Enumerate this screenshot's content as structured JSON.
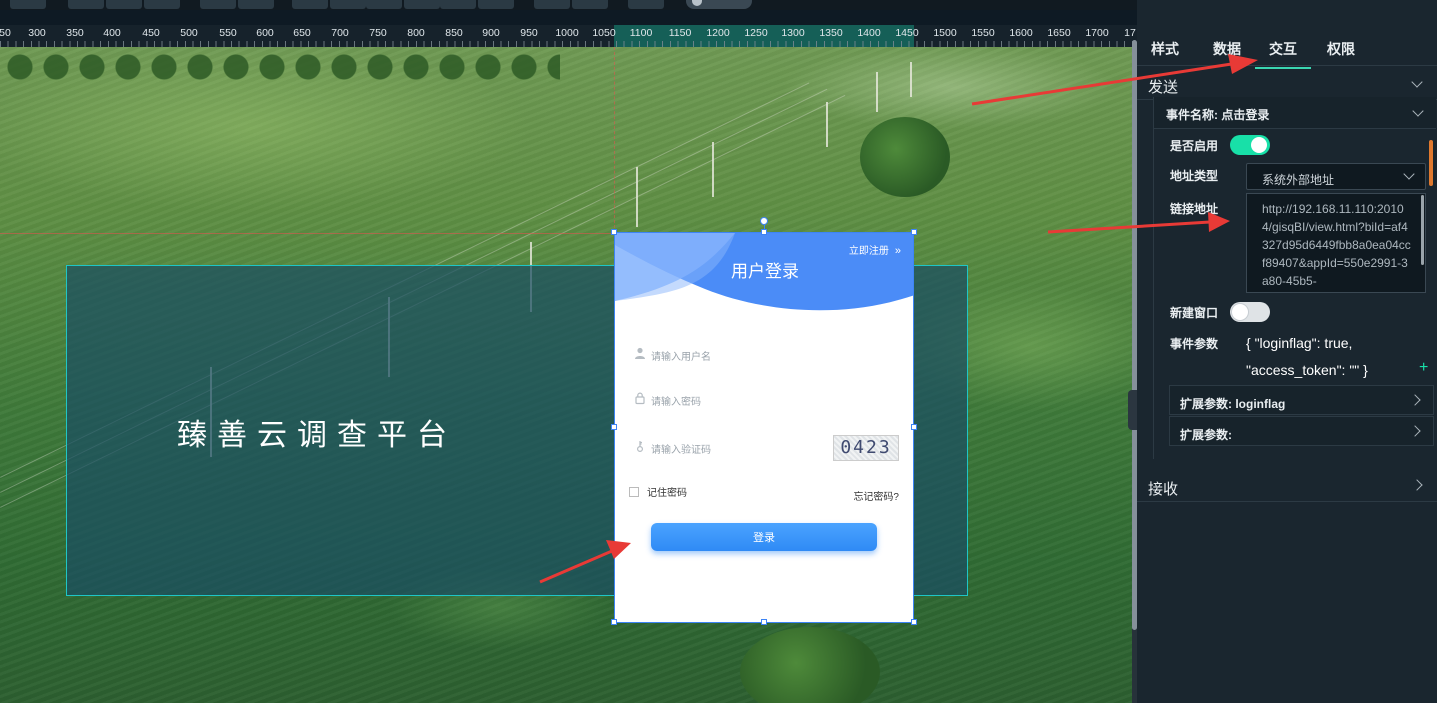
{
  "ruler": {
    "labels": [
      "50",
      "300",
      "350",
      "400",
      "450",
      "500",
      "550",
      "600",
      "650",
      "700",
      "750",
      "800",
      "850",
      "900",
      "950",
      "1000",
      "1050",
      "1100",
      "1150",
      "1200",
      "1250",
      "1300",
      "1350",
      "1400",
      "1450",
      "1500",
      "1550",
      "1600",
      "1650",
      "1700",
      "17"
    ]
  },
  "canvas": {
    "title": "臻善云调查平台",
    "login": {
      "title": "用户登录",
      "register": "立即注册",
      "username_placeholder": "请输入用户名",
      "password_placeholder": "请输入密码",
      "captcha_placeholder": "请输入验证码",
      "captcha_text": "0423",
      "remember": "记住密码",
      "forgot": "忘记密码?",
      "button": "登录"
    }
  },
  "panel": {
    "tabs": [
      "样式",
      "数据",
      "交互",
      "权限"
    ],
    "active_tab": "交互",
    "send_section": "发送",
    "event_name_label": "事件名称:",
    "event_name_value": "点击登录",
    "enabled_label": "是否启用",
    "enabled": true,
    "address_type_label": "地址类型",
    "address_type_value": "系统外部地址",
    "link_label": "链接地址",
    "link_value": "http://192.168.11.110:20104/gisqBI/view.html?biId=af4327d95d6449fbb8a0ea04ccf89407&appId=550e2991-3a80-45b5-",
    "new_window_label": "新建窗口",
    "new_window": false,
    "event_params_label": "事件参数",
    "event_params_line1": "{ \"loginflag\": true,",
    "event_params_line2": "\"access_token\": \"\" }",
    "ext_param_label": "扩展参数:",
    "ext_params": [
      "loginflag",
      ""
    ],
    "receive_section": "接收"
  },
  "colors": {
    "accent": "#18e0a8",
    "login_blue": "#3d84f5",
    "arrow_red": "#e83a36",
    "panel_bg": "#1a262f"
  }
}
